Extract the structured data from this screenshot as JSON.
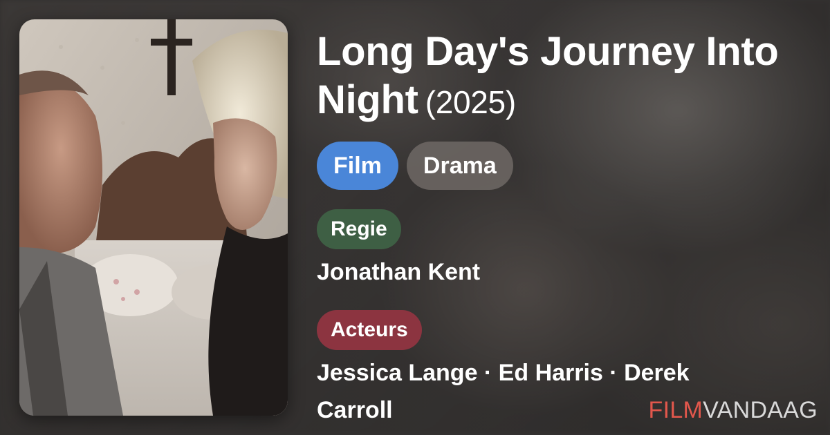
{
  "movie": {
    "title": "Long Day's Journey Into Night",
    "year": "(2025)"
  },
  "chips": {
    "type": "Film",
    "genre": "Drama"
  },
  "director": {
    "label": "Regie",
    "names": "Jonathan Kent"
  },
  "cast": {
    "label": "Acteurs",
    "names": "Jessica Lange · Ed Harris · Derek Carroll"
  },
  "brand": {
    "part1": "FILM",
    "part2": "VANDAAG"
  },
  "colors": {
    "film_chip": "#4a86d8",
    "genre_chip": "#6e6865",
    "regie_label": "#3e5f44",
    "acteurs_label": "#8c3440",
    "brand_accent": "#e2574c"
  },
  "poster": {
    "icon": "movie-still-image"
  }
}
